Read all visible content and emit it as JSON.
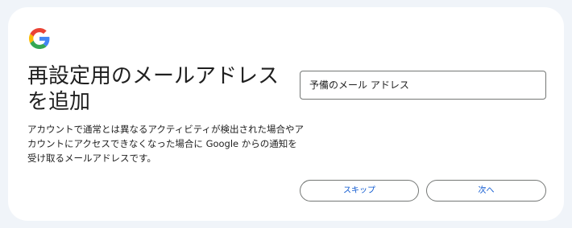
{
  "header": {
    "logo_icon": "google-g-logo",
    "brand_colors": {
      "blue": "#4285F4",
      "red": "#EA4335",
      "yellow": "#FBBC05",
      "green": "#34A853"
    }
  },
  "main": {
    "title": "再設定用のメールアドレスを追加",
    "description": "アカウントで通常とは異なるアクティビティが検出された場合やアカウントにアクセスできなくなった場合に Google からの通知を受け取るメールアドレスです。",
    "recovery_email": {
      "placeholder": "予備のメール アドレス",
      "value": ""
    }
  },
  "actions": {
    "skip_label": "スキップ",
    "next_label": "次へ",
    "accent_color": "#0b57d0"
  }
}
